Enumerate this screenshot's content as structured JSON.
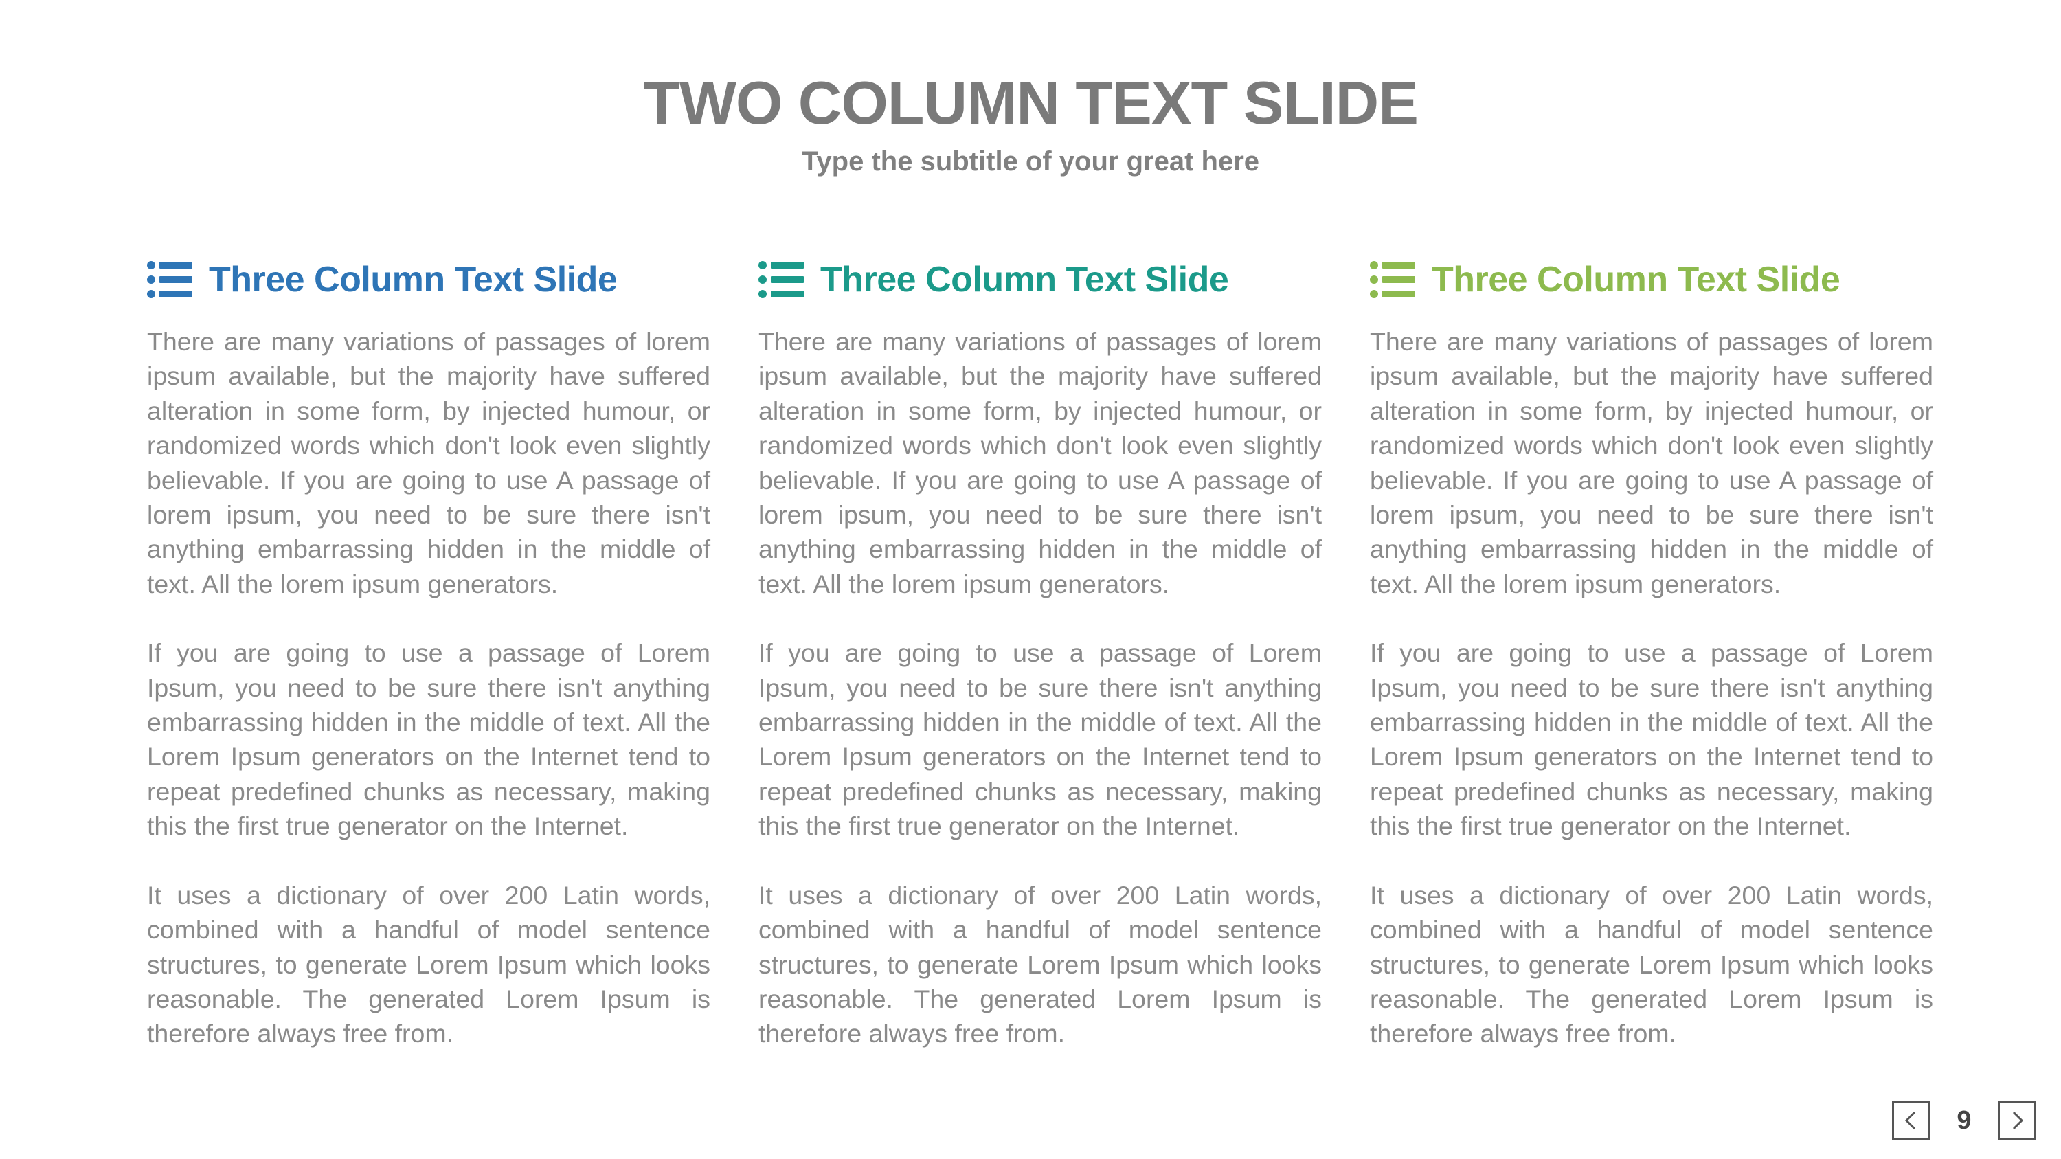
{
  "slide": {
    "title": "TWO COLUMN TEXT SLIDE",
    "subtitle": "Type the subtitle of your great here",
    "page_number": "9"
  },
  "colors": {
    "title": "#7a7a7a",
    "body_text": "#8a8a8a",
    "column_1_accent": "#2e75b6",
    "column_2_accent": "#1b9a8a",
    "column_3_accent": "#8dba4e"
  },
  "columns": [
    {
      "heading": "Three Column Text Slide",
      "icon": "list-icon",
      "accent": "#2e75b6",
      "paragraphs": [
        "There are many variations of passages of lorem ipsum available, but the majority have suffered alteration in some form, by injected humour, or randomized words which don't look even slightly believable. If you are going to use A passage of lorem ipsum, you need to be sure there isn't anything embarrassing hidden in the middle of text. All the lorem ipsum generators.",
        "If you are going to use a passage of Lorem Ipsum, you need to be sure there isn't anything embarrassing hidden in the middle of text. All the Lorem Ipsum generators on the Internet tend to repeat predefined chunks as necessary, making this the first true generator on the Internet.",
        "It uses a dictionary of over 200 Latin words, combined with a handful of model sentence structures, to generate Lorem Ipsum which looks reasonable. The generated Lorem Ipsum is therefore always free from."
      ]
    },
    {
      "heading": "Three Column Text Slide",
      "icon": "list-icon",
      "accent": "#1b9a8a",
      "paragraphs": [
        "There are many variations of passages of lorem ipsum available, but the majority have suffered alteration in some form, by injected humour, or randomized words which don't look even slightly believable. If you are going to use A passage of lorem ipsum, you need to be sure there isn't anything embarrassing hidden in the middle of text. All the lorem ipsum generators.",
        "If you are going to use a passage of Lorem Ipsum, you need to be sure there isn't anything embarrassing hidden in the middle of text. All the Lorem Ipsum generators on the Internet tend to repeat predefined chunks as necessary, making this the first true generator on the Internet.",
        "It uses a dictionary of over 200 Latin words, combined with a handful of model sentence structures, to generate Lorem Ipsum which looks reasonable. The generated Lorem Ipsum is therefore always free from."
      ]
    },
    {
      "heading": "Three Column Text Slide",
      "icon": "list-icon",
      "accent": "#8dba4e",
      "paragraphs": [
        "There are many variations of passages of lorem ipsum available, but the majority have suffered alteration in some form, by injected humour, or randomized words which don't look even slightly believable. If you are going to use A passage of lorem ipsum, you need to be sure there isn't anything embarrassing hidden in the middle of text. All the lorem ipsum generators.",
        "If you are going to use a passage of Lorem Ipsum, you need to be sure there isn't anything embarrassing hidden in the middle of text. All the Lorem Ipsum generators on the Internet tend to repeat predefined chunks as necessary, making this the first true generator on the Internet.",
        "It uses a dictionary of over 200 Latin words, combined with a handful of model sentence structures, to generate Lorem Ipsum which looks reasonable. The generated Lorem Ipsum is therefore always free from."
      ]
    }
  ],
  "pager": {
    "prev_icon": "chevron-left-icon",
    "next_icon": "chevron-right-icon"
  }
}
